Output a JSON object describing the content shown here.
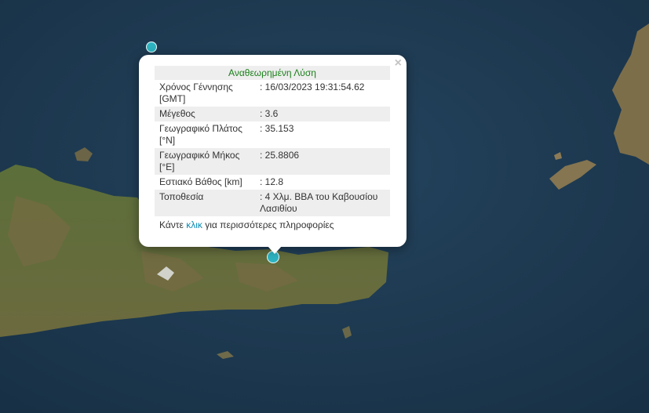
{
  "popup": {
    "close": "×",
    "title": "Αναθεωρημένη Λύση",
    "rows": [
      {
        "label": "Χρόνος Γέννησης [GMT]",
        "value": ": 16/03/2023 19:31:54.62"
      },
      {
        "label": "Μέγεθος",
        "value": ": 3.6"
      },
      {
        "label": "Γεωγραφικό Πλάτος [°N]",
        "value": ": 35.153"
      },
      {
        "label": "Γεωγραφικό Μήκος [°E]",
        "value": ": 25.8806"
      },
      {
        "label": "Εστιακό Βάθος [km]",
        "value": ": 12.8"
      },
      {
        "label": "Τοποθεσία",
        "value": ": 4 Χλμ. ΒΒΑ του Καβουσίου Λασιθίου"
      }
    ],
    "more_prefix": "Κάντε ",
    "more_link": "κλικ",
    "more_suffix": " για περισσότερες πληροφορίες"
  },
  "colors": {
    "sea": "#1d3a52",
    "land": "#4f6a35",
    "marker": "#2eb3c1",
    "title": "#1a7f1a",
    "link": "#0a8ab4"
  }
}
